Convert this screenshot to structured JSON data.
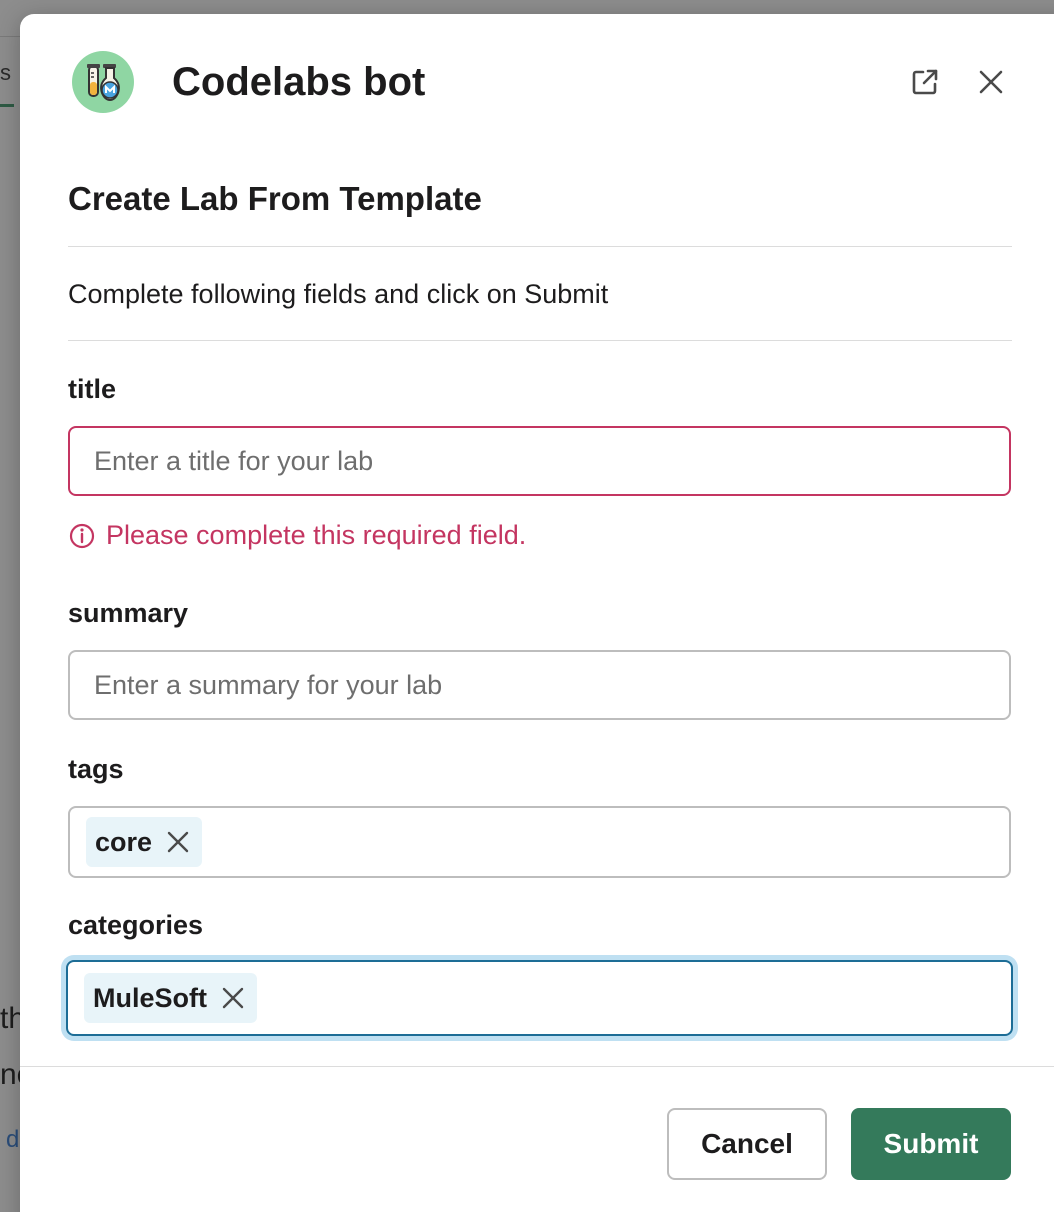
{
  "background": {
    "tab_fragment": "s",
    "text_fragment_1": "th",
    "text_fragment_2": "ne",
    "link_fragment": "d"
  },
  "modal": {
    "bot_name": "Codelabs bot",
    "section_title": "Create Lab From Template",
    "instructions": "Complete following fields and click on Submit",
    "fields": {
      "title": {
        "label": "title",
        "value": "",
        "placeholder": "Enter a title for your lab",
        "error": "Please complete this required field."
      },
      "summary": {
        "label": "summary",
        "value": "",
        "placeholder": "Enter a summary for your lab"
      },
      "tags": {
        "label": "tags",
        "chips": [
          "core"
        ]
      },
      "categories": {
        "label": "categories",
        "chips": [
          "MuleSoft"
        ]
      }
    },
    "buttons": {
      "cancel": "Cancel",
      "submit": "Submit"
    }
  },
  "colors": {
    "primary": "#347a5b",
    "error": "#c43561",
    "focus": "#1d6d96",
    "chip_bg": "#e8f4f9"
  },
  "icons": {
    "avatar": "lab-flasks-icon",
    "open_external": "external-link-icon",
    "close": "close-icon",
    "error": "info-circle-icon",
    "chip_remove": "x-icon"
  }
}
